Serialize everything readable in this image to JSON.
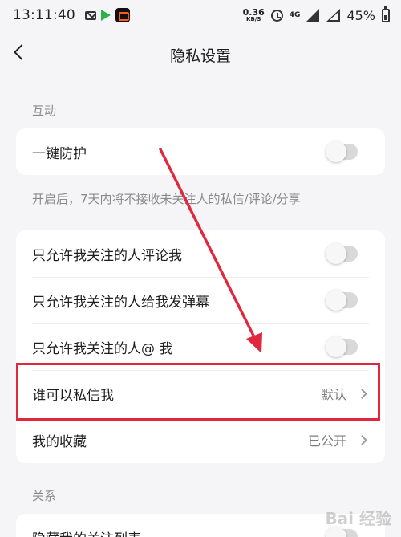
{
  "status_bar": {
    "time": "13:11:40",
    "net_speed_value": "0.36",
    "net_speed_unit": "KB/S",
    "signal_type": "4G",
    "battery": "45%"
  },
  "header": {
    "title": "隐私设置"
  },
  "sections": {
    "interaction_label": "互动",
    "relation_label": "关系"
  },
  "one_key_protect": {
    "label": "一键防护",
    "enabled": false,
    "hint": "开启后，7天内将不接收未关注人的私信/评论/分享"
  },
  "privacy_rows": [
    {
      "label": "只允许我关注的人评论我",
      "type": "toggle",
      "enabled": false
    },
    {
      "label": "只允许我关注的人给我发弹幕",
      "type": "toggle",
      "enabled": false
    },
    {
      "label": "只允许我关注的人@ 我",
      "type": "toggle",
      "enabled": false
    },
    {
      "label": "谁可以私信我",
      "type": "select",
      "value": "默认"
    },
    {
      "label": "我的收藏",
      "type": "select",
      "value": "已公开"
    }
  ],
  "relation_rows": [
    {
      "label": "隐藏我的关注列表",
      "type": "toggle",
      "enabled": false
    }
  ],
  "watermark": "Bai 经验",
  "colors": {
    "highlight": "#e0273e",
    "background": "#f5f5f7"
  }
}
